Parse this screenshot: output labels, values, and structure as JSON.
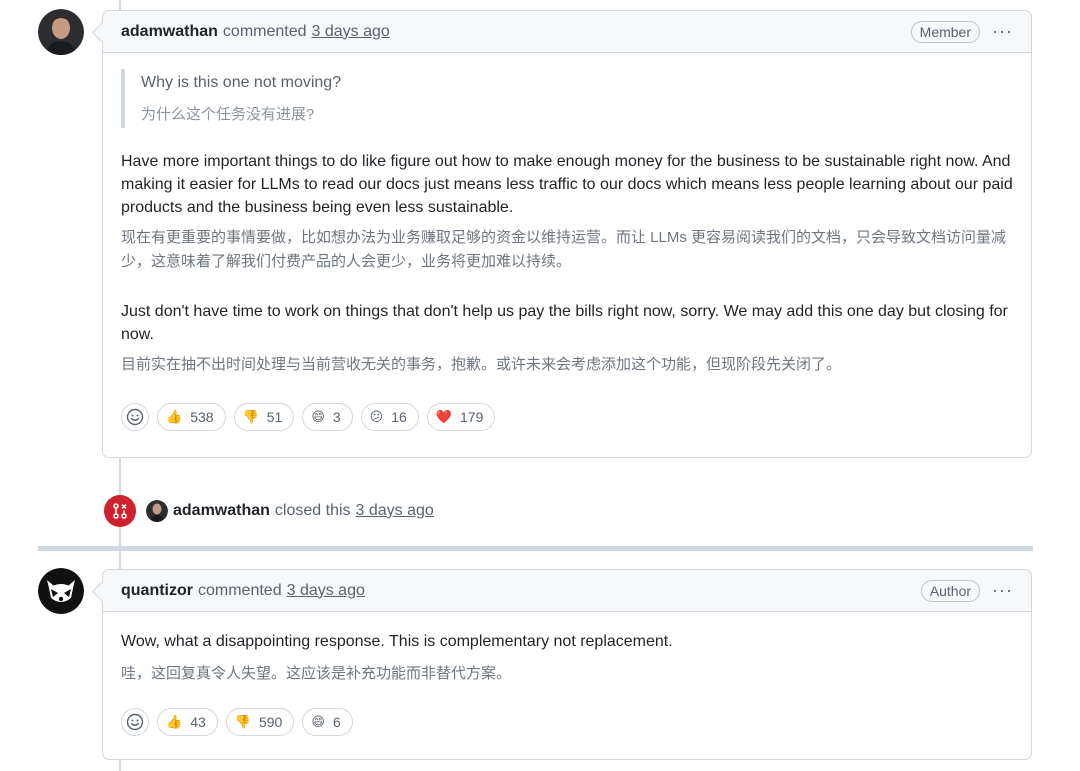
{
  "comment1": {
    "author": "adamwathan",
    "action": "commented",
    "time": "3 days ago",
    "badge": "Member",
    "menu": "···",
    "quote_en": "Why is this one not moving?",
    "quote_zh": "为什么这个任务没有进展?",
    "para1_en": "Have more important things to do like figure out how to make enough money for the business to be sustainable right now. And making it easier for LLMs to read our docs just means less traffic to our docs which means less people learning about our paid products and the business being even less sustainable.",
    "para1_zh": "现在有更重要的事情要做，比如想办法为业务赚取足够的资金以维持运营。而让 LLMs 更容易阅读我们的文档，只会导致文档访问量减少，这意味着了解我们付费产品的人会更少，业务将更加难以持续。",
    "para2_en": "Just don't have time to work on things that don't help us pay the bills right now, sorry. We may add this one day but closing for now.",
    "para2_zh": "目前实在抽不出时间处理与当前营收无关的事务，抱歉。或许未来会考虑添加这个功能，但现阶段先关闭了。",
    "reactions": [
      {
        "icon": "thumbs-up",
        "emoji": "👍",
        "count": "538"
      },
      {
        "icon": "thumbs-down",
        "emoji": "👎",
        "count": "51"
      },
      {
        "icon": "laugh",
        "emoji": "😄",
        "count": "3"
      },
      {
        "icon": "confused",
        "emoji": "😕",
        "count": "16"
      },
      {
        "icon": "heart",
        "emoji": "❤️",
        "count": "179"
      }
    ]
  },
  "event": {
    "author": "adamwathan",
    "action": "closed this",
    "time": "3 days ago"
  },
  "comment2": {
    "author": "quantizor",
    "action": "commented",
    "time": "3 days ago",
    "badge": "Author",
    "menu": "···",
    "para1_en": "Wow, what a disappointing response. This is complementary not replacement.",
    "para1_zh": "哇，这回复真令人失望。这应该是补充功能而非替代方案。",
    "reactions": [
      {
        "icon": "thumbs-up",
        "emoji": "👍",
        "count": "43"
      },
      {
        "icon": "thumbs-down",
        "emoji": "👎",
        "count": "590"
      },
      {
        "icon": "laugh",
        "emoji": "😄",
        "count": "6"
      }
    ]
  },
  "colors": {
    "border": "#d0d7de",
    "header_bg": "#f6f8fa",
    "closed_red": "#cf222e"
  }
}
